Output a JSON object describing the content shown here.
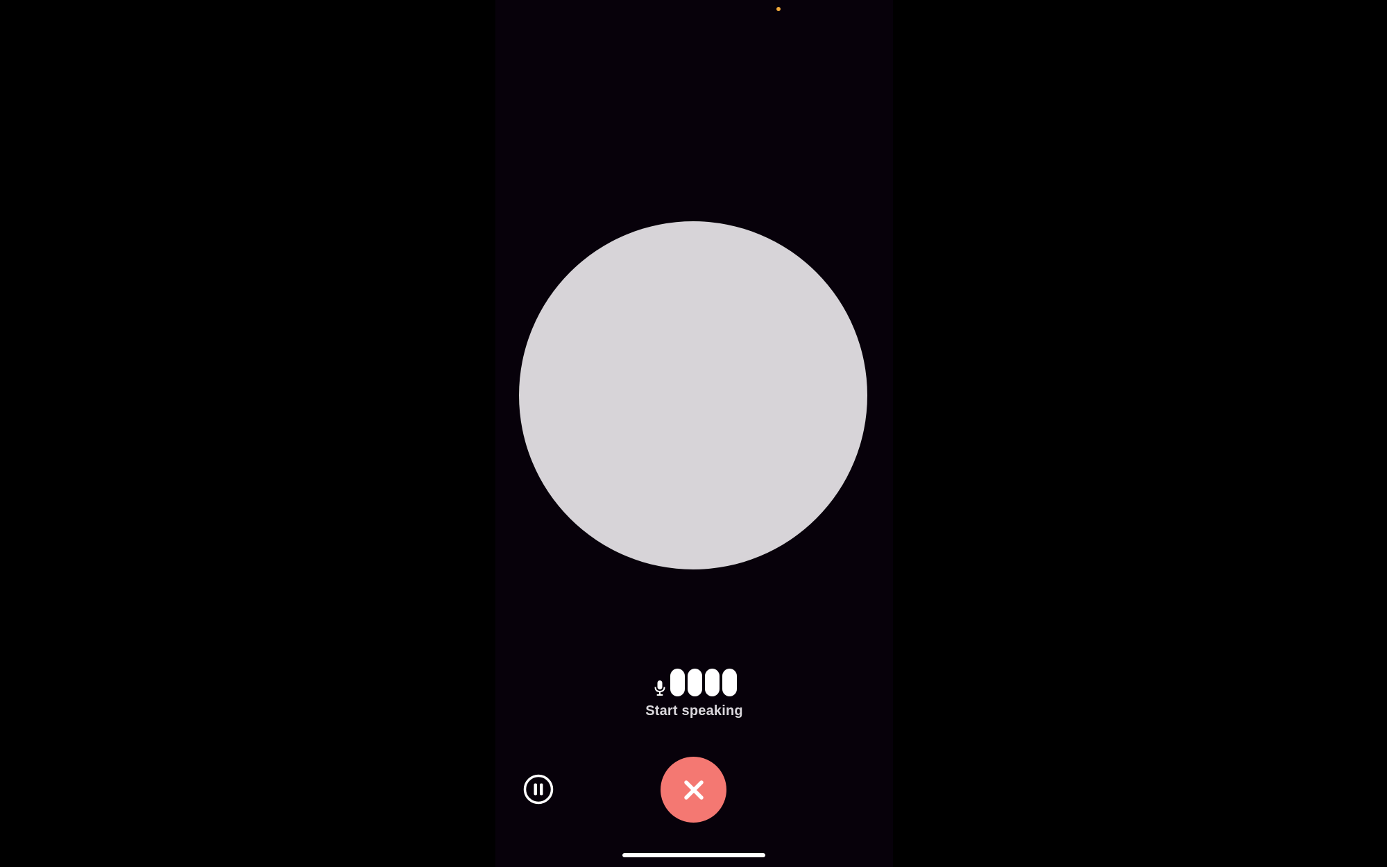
{
  "theme": {
    "page_background": "#000000",
    "screen_background": "#07010a",
    "orb_color": "#d7d4d8",
    "status_dot_color": "#f0a83a",
    "foreground": "#ffffff",
    "status_text_color": "#d9d6db",
    "end_button_color": "#f47872"
  },
  "voice": {
    "status_text": "Start speaking",
    "mic_icon": "microphone-icon",
    "level_bars": 4
  },
  "controls": {
    "pause_icon": "pause-icon",
    "end_icon": "close-icon"
  }
}
